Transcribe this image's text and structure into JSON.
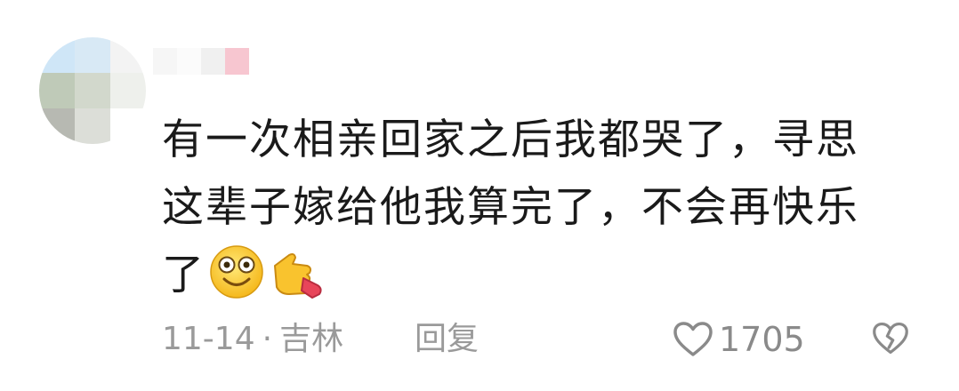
{
  "comment": {
    "body_lines": [
      "有一次相亲回家之后我都哭了，寻思",
      "这辈子嫁给他我算完了，不会再快乐",
      "了"
    ],
    "emojis": [
      "smiling-face-icon",
      "pointing-hand-icon"
    ],
    "date": "11-14",
    "separator": "·",
    "location": "吉林",
    "reply_label": "回复",
    "like_count": "1705"
  },
  "colors": {
    "text": "#1a1a1a",
    "meta": "#9a9a9a",
    "icon": "#8a8a8a",
    "avatar_mosaic": [
      "#cfe6f7",
      "#e8eef2",
      "#f2f2f2",
      "#b9c6b3",
      "#cfd6cc",
      "#eef0ec",
      "#b5b7b0",
      "#d9dbd6",
      "#ffffff"
    ],
    "username_mosaic": [
      "#f7f7f7",
      "#ffffff",
      "#f1f1f1",
      "#f6c9d2"
    ]
  }
}
